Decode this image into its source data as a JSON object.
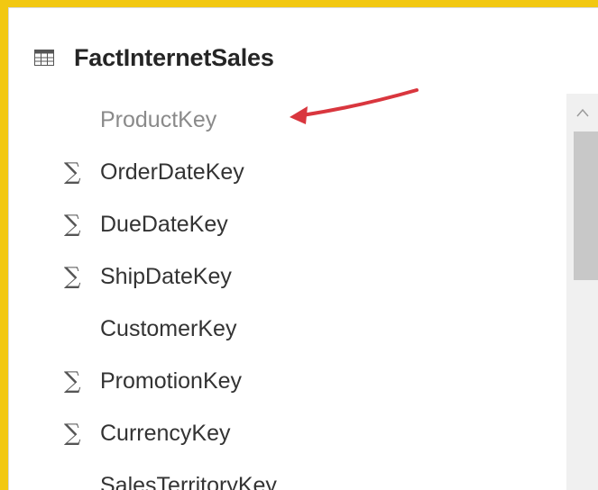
{
  "table": {
    "name": "FactInternetSales",
    "icon": "table-icon"
  },
  "fields": [
    {
      "label": "ProductKey",
      "sigma": false,
      "muted": true
    },
    {
      "label": "OrderDateKey",
      "sigma": true,
      "muted": false
    },
    {
      "label": "DueDateKey",
      "sigma": true,
      "muted": false
    },
    {
      "label": "ShipDateKey",
      "sigma": true,
      "muted": false
    },
    {
      "label": "CustomerKey",
      "sigma": false,
      "muted": false
    },
    {
      "label": "PromotionKey",
      "sigma": true,
      "muted": false
    },
    {
      "label": "CurrencyKey",
      "sigma": true,
      "muted": false
    },
    {
      "label": "SalesTerritoryKey",
      "sigma": false,
      "muted": false
    }
  ],
  "sigma_symbol": "∑",
  "colors": {
    "accent_border": "#f2c811",
    "annotation_arrow": "#d9363e",
    "scrollbar_track": "#f0f0f0",
    "scrollbar_thumb": "#c8c8c8"
  }
}
